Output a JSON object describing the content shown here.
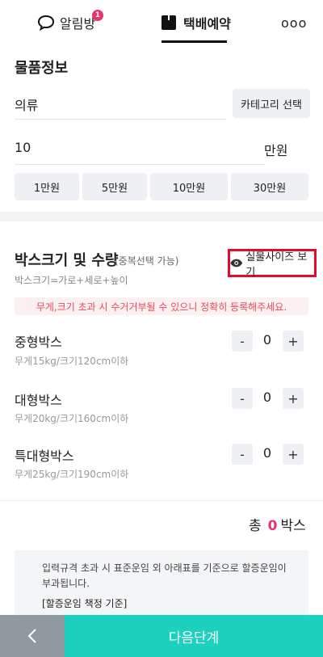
{
  "nav": {
    "chat_label": "알림방",
    "chat_badge": "1",
    "delivery_label": "택배예약",
    "more_label": "ooo"
  },
  "item_info": {
    "title": "물품정보",
    "category_value": "의류",
    "category_button": "카테고리 선택",
    "amount_value": "10",
    "amount_unit": "만원",
    "amount_buttons": [
      "1만원",
      "5만원",
      "10만원",
      "30만원"
    ]
  },
  "box": {
    "title": "박스크기 및 수량",
    "subtitle": "(중복선택 가능)",
    "formula": "박스크기=가로+세로+높이",
    "real_size_button": "실물사이즈 보기",
    "warning": "무게,크기 초과 시 수거거부될 수 있으니 정확히 등록해주세요.",
    "rows": [
      {
        "name": "중형박스",
        "desc": "무게15kg/크기120cm이하",
        "qty": "0"
      },
      {
        "name": "대형박스",
        "desc": "무게20kg/크기160cm이하",
        "qty": "0"
      },
      {
        "name": "특대형박스",
        "desc": "무게25kg/크기190cm이하",
        "qty": "0"
      }
    ],
    "minus_label": "-",
    "plus_label": "+"
  },
  "total": {
    "prefix": "총",
    "count": "0",
    "suffix": "박스"
  },
  "notice": {
    "text": "입력규격 초과 시 표준운임 외 아래표를 기준으로 할증운임이 부과됩니다.",
    "link": "[할증운임 책정 기준]"
  },
  "footer": {
    "next_label": "다음단계"
  },
  "colors": {
    "accent": "#1cd1be",
    "badge": "#e8336b",
    "warning_text": "#e84a5f",
    "highlight_border": "#e20b2c",
    "back_button": "#8e99a2"
  }
}
